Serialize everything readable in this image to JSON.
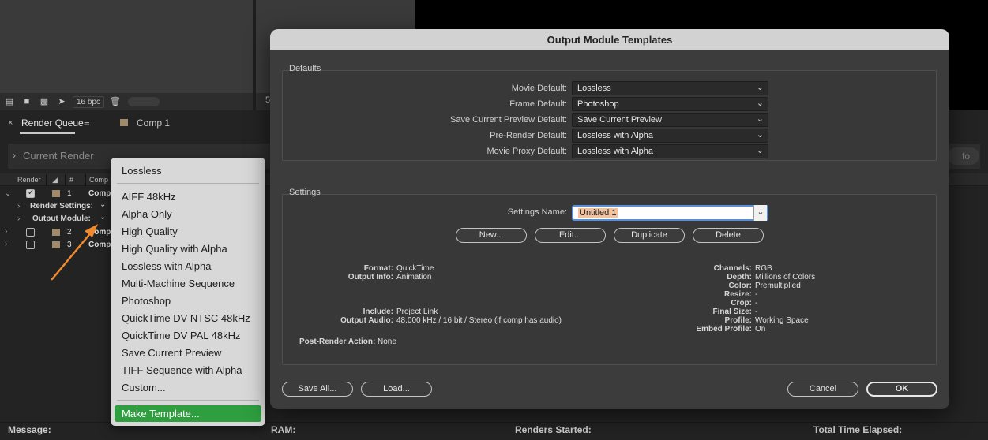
{
  "app": {
    "toolbar": {
      "bpc_label": "16 bpc",
      "mid_number": "5"
    },
    "tabs": [
      {
        "label": "Render Queue",
        "close": "×",
        "menu": "≡"
      },
      {
        "label": "Comp 1"
      }
    ],
    "current_render": {
      "label": "Current Render",
      "info_button": "fo"
    },
    "columns": {
      "render": "Render",
      "num": "#",
      "comp": "Comp"
    },
    "rows": [
      {
        "num": "1",
        "comp": "Comp",
        "checked": true
      },
      {
        "num": "2",
        "comp": "Comp",
        "checked": false
      },
      {
        "num": "3",
        "comp": "Comp",
        "checked": false
      }
    ],
    "sub_rows": {
      "render_settings": "Render Settings:",
      "output_module": "Output Module:"
    },
    "footer": {
      "message": "Message:",
      "ram": "RAM:",
      "renders_started": "Renders Started:",
      "total_time": "Total Time Elapsed:"
    }
  },
  "popup": {
    "top_item": "Lossless",
    "items": [
      "AIFF 48kHz",
      "Alpha Only",
      "High Quality",
      "High Quality with Alpha",
      "Lossless with Alpha",
      "Multi-Machine Sequence",
      "Photoshop",
      "QuickTime DV NTSC 48kHz",
      "QuickTime DV PAL 48kHz",
      "Save Current Preview",
      "TIFF Sequence with Alpha",
      "Custom..."
    ],
    "highlighted": "Make Template..."
  },
  "dialog": {
    "title": "Output Module Templates",
    "defaults": {
      "group_label": "Defaults",
      "fields": [
        {
          "label": "Movie Default:",
          "value": "Lossless"
        },
        {
          "label": "Frame Default:",
          "value": "Photoshop"
        },
        {
          "label": "Save Current Preview Default:",
          "value": "Save Current Preview"
        },
        {
          "label": "Pre-Render Default:",
          "value": "Lossless with Alpha"
        },
        {
          "label": "Movie Proxy Default:",
          "value": "Lossless with Alpha"
        }
      ]
    },
    "settings": {
      "group_label": "Settings",
      "name_label": "Settings Name:",
      "name_value": "Untitled 1",
      "buttons": {
        "new": "New...",
        "edit": "Edit...",
        "duplicate": "Duplicate",
        "delete": "Delete"
      },
      "info_left": [
        {
          "label": "Format:",
          "value": "QuickTime"
        },
        {
          "label": "Output Info:",
          "value": "Animation"
        },
        {
          "label": "Include:",
          "value": "Project Link"
        },
        {
          "label": "Output Audio:",
          "value": "48.000 kHz / 16 bit / Stereo (if comp has audio)"
        }
      ],
      "post_render": {
        "label": "Post-Render Action:",
        "value": "None"
      },
      "info_right": [
        {
          "label": "Channels:",
          "value": "RGB"
        },
        {
          "label": "Depth:",
          "value": "Millions of Colors"
        },
        {
          "label": "Color:",
          "value": "Premultiplied"
        },
        {
          "label": "Resize:",
          "value": "-"
        },
        {
          "label": "Crop:",
          "value": "-"
        },
        {
          "label": "Final Size:",
          "value": "-"
        },
        {
          "label": "Profile:",
          "value": "Working Space"
        },
        {
          "label": "Embed Profile:",
          "value": "On"
        }
      ]
    },
    "footer_buttons": {
      "save_all": "Save All...",
      "load": "Load...",
      "cancel": "Cancel",
      "ok": "OK"
    }
  },
  "colors": {
    "accent_green": "#2e9e3e",
    "arrow_orange": "#f08a2c",
    "focus_blue": "#5a8fd6"
  }
}
